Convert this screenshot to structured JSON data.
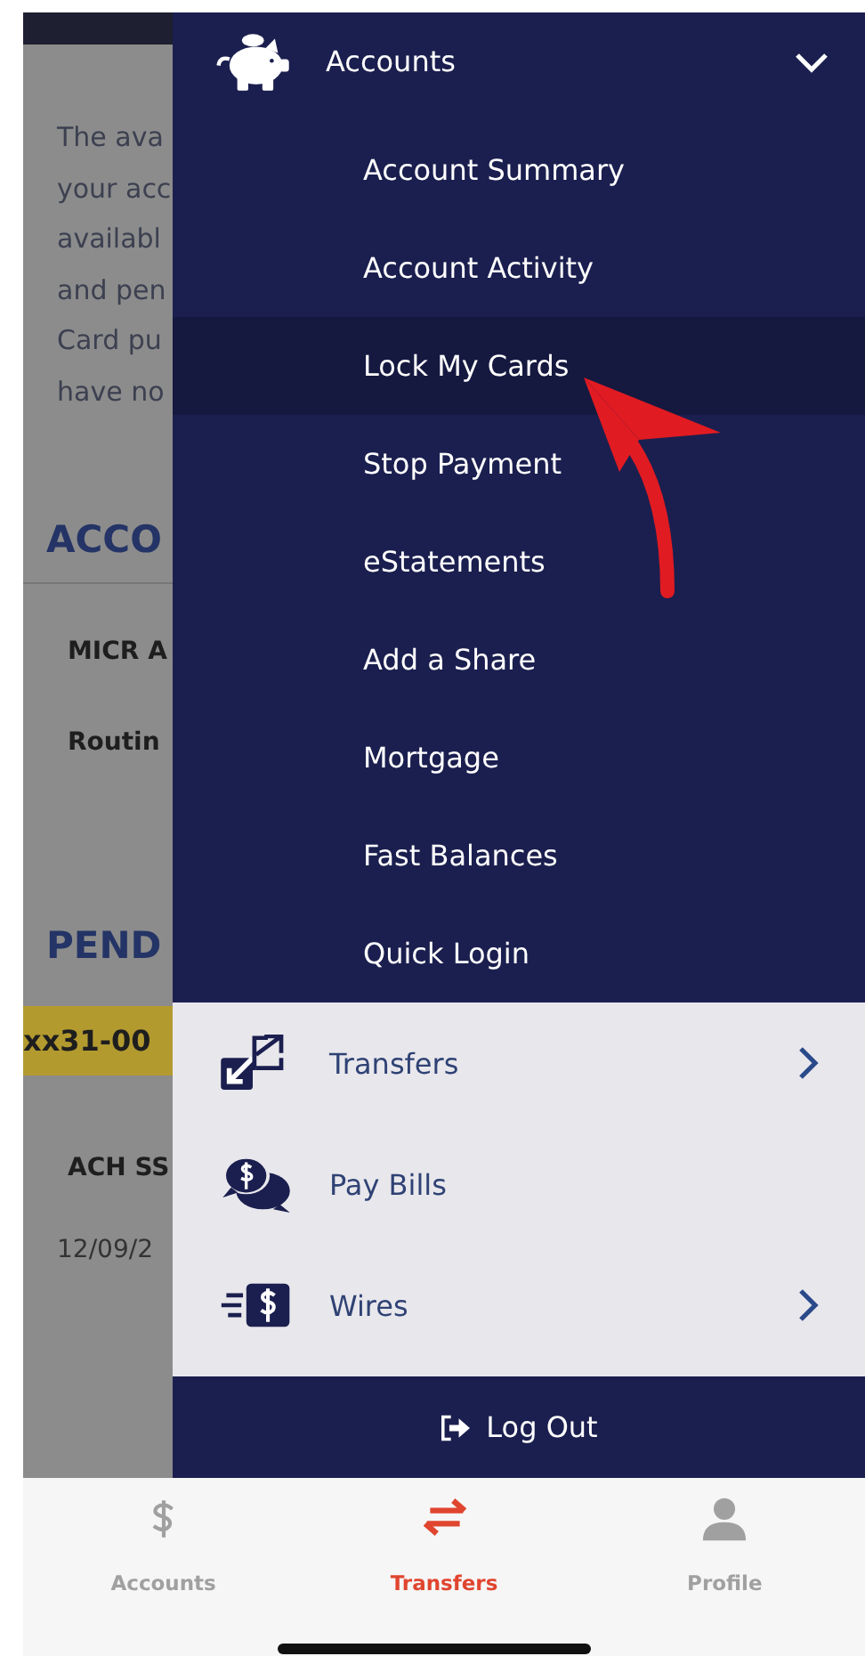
{
  "background_page": {
    "paragraph_lines": [
      "The ava",
      "your acc",
      "availabl",
      "and pen",
      "Card pu",
      "have no"
    ],
    "blocks": [
      {
        "kind": "heading",
        "text": "ACCO"
      },
      {
        "kind": "label",
        "text": "MICR A"
      },
      {
        "kind": "label",
        "text": "Routin"
      },
      {
        "kind": "heading",
        "text": "PEND"
      },
      {
        "kind": "highlight",
        "text": "xx31-00"
      },
      {
        "kind": "label",
        "text": "ACH SS"
      },
      {
        "kind": "date",
        "text": "12/09/2"
      }
    ]
  },
  "drawer": {
    "header": {
      "label": "Accounts",
      "expanded": true
    },
    "items": [
      {
        "label": "Account Summary",
        "selected": false
      },
      {
        "label": "Account Activity",
        "selected": false
      },
      {
        "label": "Lock My Cards",
        "selected": true
      },
      {
        "label": "Stop Payment",
        "selected": false
      },
      {
        "label": "eStatements",
        "selected": false
      },
      {
        "label": "Add a Share",
        "selected": false
      },
      {
        "label": "Mortgage",
        "selected": false
      },
      {
        "label": "Fast Balances",
        "selected": false
      },
      {
        "label": "Quick Login",
        "selected": false
      }
    ],
    "sections": [
      {
        "label": "Transfers",
        "kind": "transfers",
        "has_submenu": true
      },
      {
        "label": "Pay Bills",
        "kind": "bills",
        "has_submenu": false
      },
      {
        "label": "Wires",
        "kind": "wires",
        "has_submenu": true
      }
    ],
    "logout": "Log Out"
  },
  "tab_bar": [
    {
      "label": "Accounts",
      "kind": "dollar",
      "selected": false
    },
    {
      "label": "Transfers",
      "kind": "transfer",
      "selected": true
    },
    {
      "label": "Profile",
      "kind": "person",
      "selected": false
    }
  ]
}
